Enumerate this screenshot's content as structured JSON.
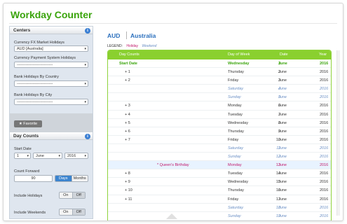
{
  "app": {
    "title": "Workday Counter"
  },
  "sidebar": {
    "centers": {
      "heading": "Centers",
      "currency_fx_label": "Currency FX Market Holidays",
      "currency_fx_value": "AUD [Australia]",
      "currency_payment_label": "Currency Payment System Holidays",
      "currency_payment_value": "----------------------------",
      "bank_country_label": "Bank Holidays By Country",
      "bank_country_value": "----------------------------",
      "bank_city_label": "Bank Holidays By City",
      "bank_city_value": "----------------------------",
      "favorite_label": "★ Favorite"
    },
    "day_counts": {
      "heading": "Day Counts",
      "start_date_label": "Start Date",
      "start_day": "1",
      "start_month": "June",
      "start_year": "2016",
      "count_forward_label": "Count Forward",
      "count_forward_value": "90",
      "days_label": "Days",
      "months_label": "Months",
      "include_holidays_label": "Include Holidays",
      "include_weekends_label": "Include Weekends",
      "on_label": "On",
      "off_label": "Off"
    }
  },
  "main": {
    "currency": "AUD",
    "country": "Australia",
    "legend_label": "LEGEND:",
    "legend_holiday": "Holiday",
    "legend_weekend": "Weekend",
    "columns": {
      "day_counts": "Day Counts",
      "day_of_week": "Day of Week",
      "date": "Date",
      "year": "Year"
    },
    "rows": [
      {
        "type": "start",
        "label": "Start Date",
        "dow": "Wednesday",
        "day": "1",
        "month": "June",
        "year": "2016"
      },
      {
        "type": "normal",
        "label": "+ 1",
        "dow": "Thursday",
        "day": "2",
        "month": "June",
        "year": "2016"
      },
      {
        "type": "normal",
        "label": "+ 2",
        "dow": "Friday",
        "day": "3",
        "month": "June",
        "year": "2016"
      },
      {
        "type": "weekend",
        "label": "",
        "dow": "Saturday",
        "day": "4",
        "month": "June",
        "year": "2016"
      },
      {
        "type": "weekend",
        "label": "",
        "dow": "Sunday",
        "day": "5",
        "month": "June",
        "year": "2016"
      },
      {
        "type": "normal",
        "label": "+ 3",
        "dow": "Monday",
        "day": "6",
        "month": "June",
        "year": "2016"
      },
      {
        "type": "normal",
        "label": "+ 4",
        "dow": "Tuesday",
        "day": "7",
        "month": "June",
        "year": "2016"
      },
      {
        "type": "normal",
        "label": "+ 5",
        "dow": "Wednesday",
        "day": "8",
        "month": "June",
        "year": "2016"
      },
      {
        "type": "normal",
        "label": "+ 6",
        "dow": "Thursday",
        "day": "9",
        "month": "June",
        "year": "2016"
      },
      {
        "type": "normal",
        "label": "+ 7",
        "dow": "Friday",
        "day": "10",
        "month": "June",
        "year": "2016"
      },
      {
        "type": "weekend",
        "label": "",
        "dow": "Saturday",
        "day": "11",
        "month": "June",
        "year": "2016"
      },
      {
        "type": "weekend",
        "label": "",
        "dow": "Sunday",
        "day": "12",
        "month": "June",
        "year": "2016"
      },
      {
        "type": "holiday",
        "label": "* Queen's Birthday",
        "dow": "Monday",
        "day": "13",
        "month": "June",
        "year": "2016"
      },
      {
        "type": "normal",
        "label": "+ 8",
        "dow": "Tuesday",
        "day": "14",
        "month": "June",
        "year": "2016"
      },
      {
        "type": "normal",
        "label": "+ 9",
        "dow": "Wednesday",
        "day": "15",
        "month": "June",
        "year": "2016"
      },
      {
        "type": "normal",
        "label": "+ 10",
        "dow": "Thursday",
        "day": "16",
        "month": "June",
        "year": "2016"
      },
      {
        "type": "normal",
        "label": "+ 11",
        "dow": "Friday",
        "day": "17",
        "month": "June",
        "year": "2016"
      },
      {
        "type": "weekend",
        "label": "",
        "dow": "Saturday",
        "day": "18",
        "month": "June",
        "year": "2016"
      },
      {
        "type": "weekend",
        "label": "",
        "dow": "Sunday",
        "day": "19",
        "month": "June",
        "year": "2016"
      }
    ]
  }
}
